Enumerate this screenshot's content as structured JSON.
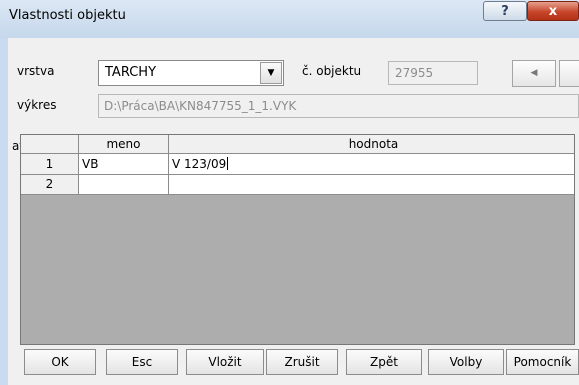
{
  "window": {
    "title": "Vlastnosti objektu",
    "help_label": "?",
    "close_label": "x"
  },
  "form": {
    "vrstva_label": "vrstva",
    "vrstva_value": "TARCHY",
    "dropdown_arrow": "▼",
    "objekt_label": "č. objektu",
    "objekt_value": "27955",
    "nav_prev": "◀",
    "vykres_label": "výkres",
    "vykres_value": "D:\\Práca\\BA\\KN847755_1_1.VYK",
    "atributy_label": "atributy"
  },
  "table": {
    "columns": [
      "meno",
      "hodnota"
    ],
    "rows": [
      {
        "num": "1",
        "meno": "VB",
        "hodnota": "V 123/09"
      },
      {
        "num": "2",
        "meno": "",
        "hodnota": ""
      }
    ]
  },
  "buttons": {
    "ok": "OK",
    "esc": "Esc",
    "vlozit": "Vložit",
    "zrusit": "Zrušit",
    "zpet": "Zpět",
    "volby": "Volby",
    "pomocnik": "Pomocník"
  }
}
